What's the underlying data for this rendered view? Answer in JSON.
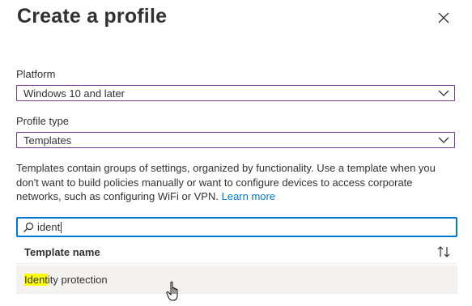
{
  "panel": {
    "title": "Create a profile",
    "close_icon": "close-icon"
  },
  "platform": {
    "label": "Platform",
    "value": "Windows 10 and later"
  },
  "profile_type": {
    "label": "Profile type",
    "value": "Templates"
  },
  "description": {
    "text": "Templates contain groups of settings, organized by functionality. Use a template when you don't want to build policies manually or want to configure devices to access corporate networks, such as configuring WiFi or VPN.",
    "link": "Learn more"
  },
  "search": {
    "value": "ident",
    "icon": "search-icon"
  },
  "table": {
    "header": "Template name",
    "sort_icon": "sort-icon",
    "rows": [
      {
        "match": "Ident",
        "rest": "ity protection"
      }
    ]
  },
  "colors": {
    "focus_border": "#0078d4",
    "select_border": "#7a3b94",
    "highlight": "#ffff00",
    "link": "#0078d4",
    "row_hover": "#f3f2f1"
  }
}
